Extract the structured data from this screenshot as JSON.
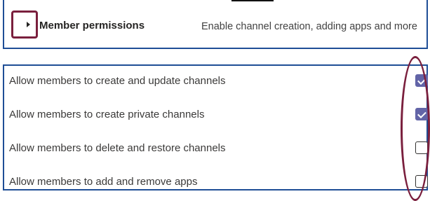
{
  "header": {
    "title": "Member permissions",
    "description": "Enable channel creation, adding apps and more",
    "expander_icon": "chevron-right-icon",
    "expanded": false
  },
  "permissions": [
    {
      "label": "Allow members to create and update channels",
      "checked": true
    },
    {
      "label": "Allow members to create private channels",
      "checked": true
    },
    {
      "label": "Allow members to delete and restore channels",
      "checked": false
    },
    {
      "label": "Allow members to add and remove apps",
      "checked": false
    }
  ],
  "colors": {
    "panel_border": "#1f4e96",
    "annotation": "#7a1f3d",
    "checkbox_checked": "#6264a7"
  }
}
